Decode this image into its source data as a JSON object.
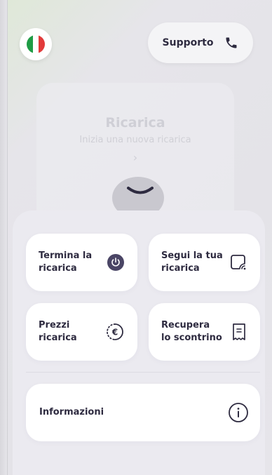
{
  "header": {
    "flag_colors": [
      "#1f9c45",
      "#ffffff",
      "#e23a3a"
    ],
    "support_label": "Supporto",
    "support_icon": "phone-icon"
  },
  "recharge": {
    "title": "Ricarica",
    "subtitle": "Inizia una nuova ricarica",
    "arrow": "›"
  },
  "menu": {
    "items": [
      {
        "label": "Termina la\nricarica",
        "icon": "power-icon"
      },
      {
        "label": "Segui la tua\nricarica",
        "icon": "charge-tracking-icon"
      },
      {
        "label": "Prezzi\nricarica",
        "icon": "euro-icon"
      },
      {
        "label": "Recupera\nlo scontrino",
        "icon": "receipt-icon"
      },
      {
        "label": "Informazioni",
        "icon": "info-icon"
      }
    ]
  },
  "colors": {
    "accent": "#4a4565",
    "text": "#2e2b40",
    "tile": "#ffffff",
    "sheet": "#ebeaf0"
  }
}
